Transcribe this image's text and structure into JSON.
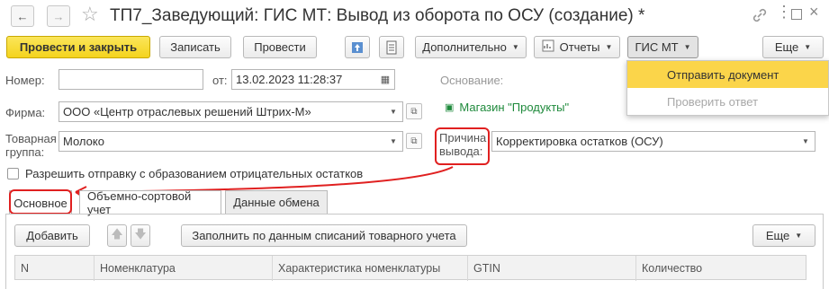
{
  "window": {
    "title": "ТП7_Заведующий: ГИС МТ: Вывод из оборота по ОСУ (создание) *"
  },
  "toolbar": {
    "post_close_label": "Провести и закрыть",
    "save_label": "Записать",
    "post_label": "Провести",
    "more_label": "Дополнительно",
    "reports_label": "Отчеты",
    "gis_label": "ГИС МТ",
    "etc_label": "Еще"
  },
  "gis_menu": {
    "items": [
      {
        "label": "Отправить документ",
        "state": "highlighted"
      },
      {
        "label": "Проверить ответ",
        "state": "disabled"
      }
    ]
  },
  "form": {
    "number_label": "Номер:",
    "number_value": "",
    "date_label": "от:",
    "date_value": "13.02.2023 11:28:37",
    "basis_label": "Основание:",
    "org_label": "Фирма:",
    "org_value": "ООО «Центр отраслевых решений Штрих-М»",
    "store_link": "Магазин \"Продукты\"",
    "group_label_1": "Товарная",
    "group_label_2": "группа:",
    "group_value": "Молоко",
    "reason_label_1": "Причина",
    "reason_label_2": "вывода:",
    "reason_value": "Корректировка остатков (ОСУ)",
    "allow_negative_label": "Разрешить отправку с образованием отрицательных остатков",
    "allow_negative_checked": false
  },
  "tabs": [
    {
      "label": "Основное"
    },
    {
      "label": "Объемно-сортовой учет"
    },
    {
      "label": "Данные обмена"
    }
  ],
  "table_toolbar": {
    "add_label": "Добавить",
    "fill_label": "Заполнить по данным списаний товарного учета",
    "etc_label": "Еще"
  },
  "table": {
    "columns": [
      "N",
      "Номенклатура",
      "Характеристика номенклатуры",
      "GTIN",
      "Количество"
    ]
  },
  "colors": {
    "primary_button": "#f4d31d",
    "menu_highlight": "#fbd54a",
    "link_green": "#1f8a3c",
    "annotation_red": "#e02020"
  }
}
